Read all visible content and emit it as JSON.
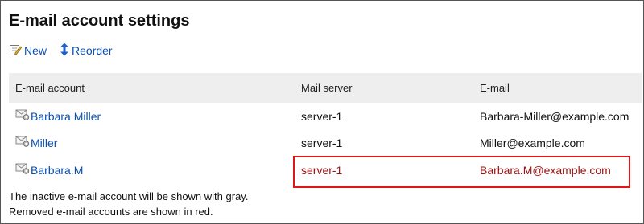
{
  "page": {
    "title": "E-mail account settings"
  },
  "toolbar": {
    "new_label": "New",
    "reorder_label": "Reorder"
  },
  "table": {
    "headers": {
      "account": "E-mail account",
      "server": "Mail server",
      "email": "E-mail"
    },
    "rows": [
      {
        "account": "Barbara Miller",
        "server": "server-1",
        "email": "Barbara-Miller@example.com",
        "status": "active"
      },
      {
        "account": "Miller",
        "server": "server-1",
        "email": "Miller@example.com",
        "status": "active"
      },
      {
        "account": "Barbara.M",
        "server": "server-1",
        "email": "Barbara.M@example.com",
        "status": "removed"
      }
    ]
  },
  "notes": {
    "inactive": "The inactive e-mail account will be shown with gray.",
    "removed": "Removed e-mail accounts are shown in red."
  },
  "colors": {
    "link": "#0a4fb0",
    "removed": "#9b1111",
    "header_bg": "#eeeeee",
    "highlight": "#e01515"
  },
  "icons": {
    "new": "new-icon",
    "reorder": "reorder-icon",
    "account": "mail-account-icon"
  }
}
